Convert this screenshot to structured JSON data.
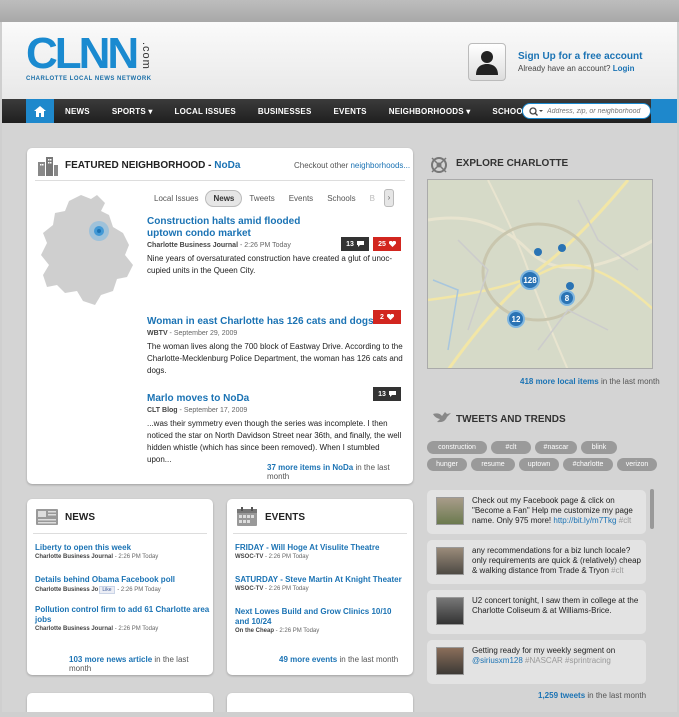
{
  "header": {
    "logo_text": "CLNN",
    "logo_com": ".com",
    "logo_tagline": "CHARLOTTE LOCAL NEWS NETWORK",
    "signup": "Sign Up for a free account",
    "account_prefix": "Already have an account?",
    "login": "Login"
  },
  "nav": {
    "items": [
      "NEWS",
      "SPORTS ▾",
      "LOCAL ISSUES",
      "BUSINESSES",
      "EVENTS",
      "NEIGHBORHOODS ▾",
      "SCHOOLS"
    ],
    "search_placeholder": "Address, zip, or neighborhood"
  },
  "featured": {
    "title_prefix": "FEATURED NEIGHBORHOOD - ",
    "title_name": "NoDa",
    "other_prefix": "Checkout other ",
    "other_link": "neighborhoods...",
    "tabs": [
      "Local Issues",
      "News",
      "Tweets",
      "Events",
      "Schools",
      "B"
    ],
    "stories": [
      {
        "title": "Construction halts amid flooded uptown condo market",
        "source": "Charlotte Business Journal",
        "time": " - 2:26 PM Today",
        "body": "Nine years of oversaturated construction have created a glut of unoc-cupied units in the Queen City.",
        "comments": "13",
        "likes": "25"
      },
      {
        "title": "Woman in east Charlotte has 126 cats and dogs",
        "source": "WBTV",
        "time": " - September 29, 2009",
        "body": "The woman lives along the 700 block of Eastway Drive.  According to the Charlotte-Mecklenburg Police Department, the woman has 126 cats and dogs.",
        "likes": "2"
      },
      {
        "title": "Marlo moves to NoDa",
        "source": "CLT Blog",
        "time": " - September 17, 2009",
        "body": "...was their symmetry even though the series was incomplete. I then noticed the star on North Davidson Street near 36th, and finally, the well hidden whistle (which has since been removed). When I stumbled upon...",
        "comments": "13"
      }
    ],
    "more_count": "37 more items in NoDa",
    "more_suffix": " in the last month"
  },
  "explore": {
    "title": "EXPLORE CHARLOTTE",
    "markers": [
      "128",
      "8",
      "12"
    ],
    "more_count": "418 more local items",
    "more_suffix": " in the last month"
  },
  "tweets": {
    "title": "TWEETS AND TRENDS",
    "tags": [
      "construction",
      "#clt",
      "#nascar",
      "blink",
      "hunger",
      "resume",
      "uptown",
      "#charlotte",
      "verizon"
    ],
    "items": [
      {
        "text": "Check out my Facebook page & click on \"Become a Fan\" Help me customize my page name. Only 975 more! ",
        "link": "http://bit.ly/m7Tkg",
        "tag": " #clt"
      },
      {
        "text": "any recommendations for a biz lunch locale? only requirements are quick & (relatively) cheap & walking distance from Trade & Tryon",
        "link": "",
        "tag": " #clt"
      },
      {
        "text": "U2 concert tonight, I saw them in college at the Charlotte Coliseum & at Williams-Brice.",
        "link": "",
        "tag": ""
      },
      {
        "text": "Getting ready for my weekly segment on ",
        "link": "@siriusxm128",
        "tag": " #NASCAR #sprintracing"
      }
    ],
    "more_count": "1,259 tweets",
    "more_suffix": " in the last month"
  },
  "news": {
    "title": "NEWS",
    "items": [
      {
        "title": "Liberty to open this week",
        "source": "Charlotte Business Journal",
        "time": " - 2:26 PM Today"
      },
      {
        "title": "Details behind Obama Facebook poll",
        "source": "Charlotte Business Jo",
        "time": " - 2:26 PM Today",
        "like": "Like"
      },
      {
        "title": "Pollution control firm to add 61 Charlotte area jobs",
        "source": "Charlotte Business Journal",
        "time": " - 2:26 PM Today"
      }
    ],
    "more_count": "103 more news article",
    "more_suffix": " in the last month"
  },
  "events": {
    "title": "EVENTS",
    "items": [
      {
        "title": "FRIDAY - Will Hoge At Visulite Theatre",
        "source": "WSOC-TV",
        "time": " - 2:26 PM Today"
      },
      {
        "title": "SATURDAY - Steve Martin At Knight Theater",
        "source": "WSOC-TV",
        "time": " - 2:26 PM Today"
      },
      {
        "title": "Next Lowes Build and Grow Clinics 10/10 and 10/24",
        "source": "On the Cheap",
        "time": " - 2:26 PM Today"
      }
    ],
    "more_count": "49 more events",
    "more_suffix": " in the last month"
  },
  "colors": {
    "accent": "#1b73b4",
    "nav": "#2a2a2a",
    "alert": "#d2261f"
  }
}
